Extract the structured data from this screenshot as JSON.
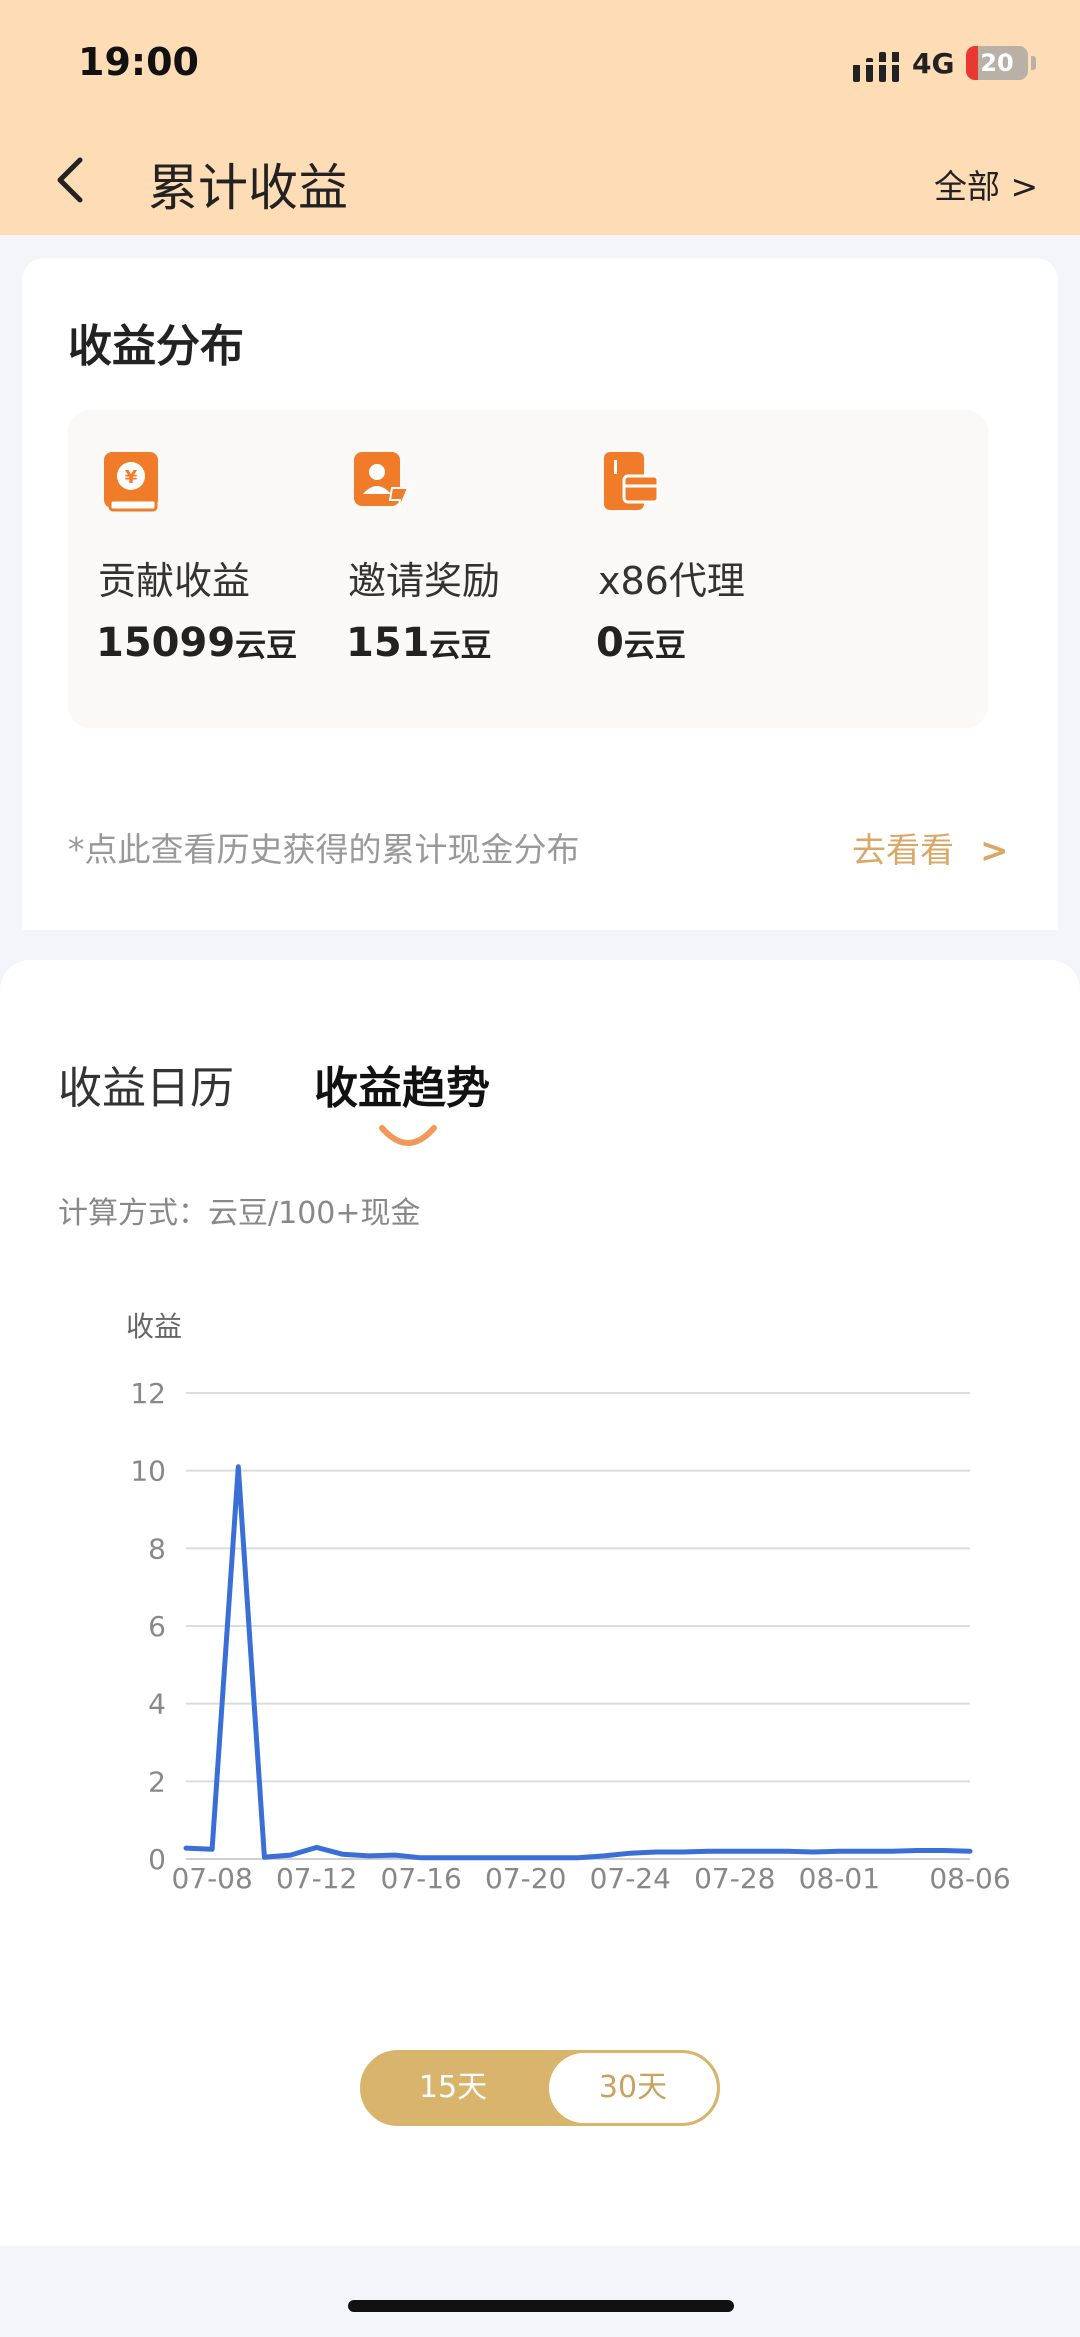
{
  "status_bar": {
    "time": "19:00",
    "network": "4G",
    "battery": "20",
    "battery_level": 0.2
  },
  "nav": {
    "title": "累计收益",
    "right_link": "全部 >"
  },
  "distribution": {
    "title": "收益分布",
    "tiles": [
      {
        "label": "贡献收益",
        "value": "15099",
        "unit": "云豆",
        "icon": "yen-book-icon",
        "help_icon": "help-circle-icon"
      },
      {
        "label": "邀请奖励",
        "value": "151",
        "unit": "云豆",
        "icon": "invite-user-icon",
        "help_icon": "chevron-right-circle-icon"
      },
      {
        "label": "x86代理",
        "value": "0",
        "unit": "云豆",
        "icon": "card-icon"
      }
    ],
    "note": "*点此查看历史获得的累计现金分布",
    "go_label": "去看看",
    "go_arrow": ">"
  },
  "trend": {
    "tabs": [
      "收益日历",
      "收益趋势"
    ],
    "active_tab": 1,
    "calc_note": "计算方式：云豆/100+现金"
  },
  "chart_data": {
    "type": "line",
    "ylabel": "收益",
    "ylim": [
      0,
      12
    ],
    "yticks": [
      0,
      2,
      4,
      6,
      8,
      10,
      12
    ],
    "x_ticks": [
      "07-08",
      "07-12",
      "07-16",
      "07-20",
      "07-24",
      "07-28",
      "08-01",
      "08-06"
    ],
    "x": [
      "07-07",
      "07-08",
      "07-09",
      "07-10",
      "07-11",
      "07-12",
      "07-13",
      "07-14",
      "07-15",
      "07-16",
      "07-17",
      "07-18",
      "07-19",
      "07-20",
      "07-21",
      "07-22",
      "07-23",
      "07-24",
      "07-25",
      "07-26",
      "07-27",
      "07-28",
      "07-29",
      "07-30",
      "07-31",
      "08-01",
      "08-02",
      "08-03",
      "08-04",
      "08-05",
      "08-06"
    ],
    "values": [
      0.28,
      0.25,
      10.1,
      0.05,
      0.1,
      0.3,
      0.12,
      0.08,
      0.1,
      0.03,
      0.03,
      0.03,
      0.03,
      0.03,
      0.03,
      0.03,
      0.08,
      0.15,
      0.18,
      0.18,
      0.2,
      0.2,
      0.2,
      0.2,
      0.18,
      0.2,
      0.2,
      0.2,
      0.22,
      0.22,
      0.2
    ],
    "grid": true,
    "color": "#3a6fd8"
  },
  "range_toggle": {
    "options": [
      "15天",
      "30天"
    ],
    "selected": 0
  },
  "colors": {
    "header_bg": "#fedcb5",
    "accent": "#d9a766",
    "toggle": "#d9b46d",
    "tile_icon": "#f07c2a"
  }
}
